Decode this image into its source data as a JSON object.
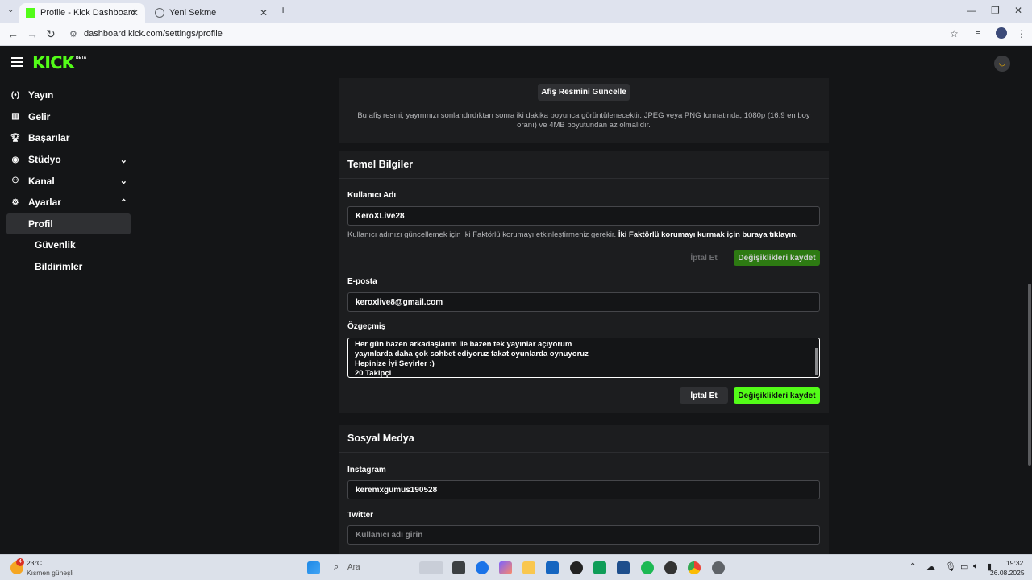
{
  "browser": {
    "tabs": [
      {
        "title": "Profile - Kick Dashboard"
      },
      {
        "title": "Yeni Sekme"
      }
    ],
    "url": "dashboard.kick.com/settings/profile"
  },
  "app": {
    "logo": "KICK",
    "logo_badge": "BETA",
    "accent": "#53fc18"
  },
  "sidebar": {
    "items": [
      {
        "label": "Yayın",
        "icon": "broadcast-icon"
      },
      {
        "label": "Gelir",
        "icon": "revenue-icon"
      },
      {
        "label": "Başarılar",
        "icon": "trophy-icon"
      },
      {
        "label": "Stüdyo",
        "icon": "studio-icon",
        "expanded": false
      },
      {
        "label": "Kanal",
        "icon": "channel-icon",
        "expanded": false
      },
      {
        "label": "Ayarlar",
        "icon": "gear-icon",
        "expanded": true
      }
    ],
    "subitems": [
      {
        "label": "Profil",
        "active": true
      },
      {
        "label": "Güvenlik"
      },
      {
        "label": "Bildirimler"
      }
    ]
  },
  "banner": {
    "button": "Afiş Resmini Güncelle",
    "description": "Bu afiş resmi, yayınınızı sonlandırdıktan sonra iki dakika boyunca görüntülenecektir. JPEG veya PNG formatında, 1080p (16:9 en boy oranı) ve 4MB boyutundan az olmalıdır."
  },
  "basic": {
    "title": "Temel Bilgiler",
    "username_label": "Kullanıcı Adı",
    "username_value": "KeroXLive28",
    "username_hint": "Kullanıcı adınızı güncellemek için İki Faktörlü korumayı etkinleştirmeniz gerekir.",
    "username_hint_link": "İki Faktörlü korumayı kurmak için buraya tıklayın.",
    "cancel": "İptal Et",
    "save": "Değişiklikleri kaydet",
    "email_label": "E-posta",
    "email_value": "keroxlive8@gmail.com",
    "bio_label": "Özgeçmiş",
    "bio_lines": [
      "Her gün bazen arkadaşlarım ile bazen tek yayınlar açıyorum",
      "yayınlarda daha çok sohbet ediyoruz fakat oyunlarda oynuyoruz",
      "Hepinize İyi Seyirler :)",
      "20 Takipçi"
    ]
  },
  "social": {
    "title": "Sosyal Medya",
    "instagram_label": "Instagram",
    "instagram_value": "keremxgumus190528",
    "twitter_label": "Twitter",
    "twitter_placeholder": "Kullanıcı adı girin"
  },
  "taskbar": {
    "weather_temp": "23°C",
    "weather_desc": "Kısmen güneşli",
    "weather_badge": "4",
    "search_placeholder": "Ara",
    "time": "19:32",
    "date": "26.08.2025"
  }
}
